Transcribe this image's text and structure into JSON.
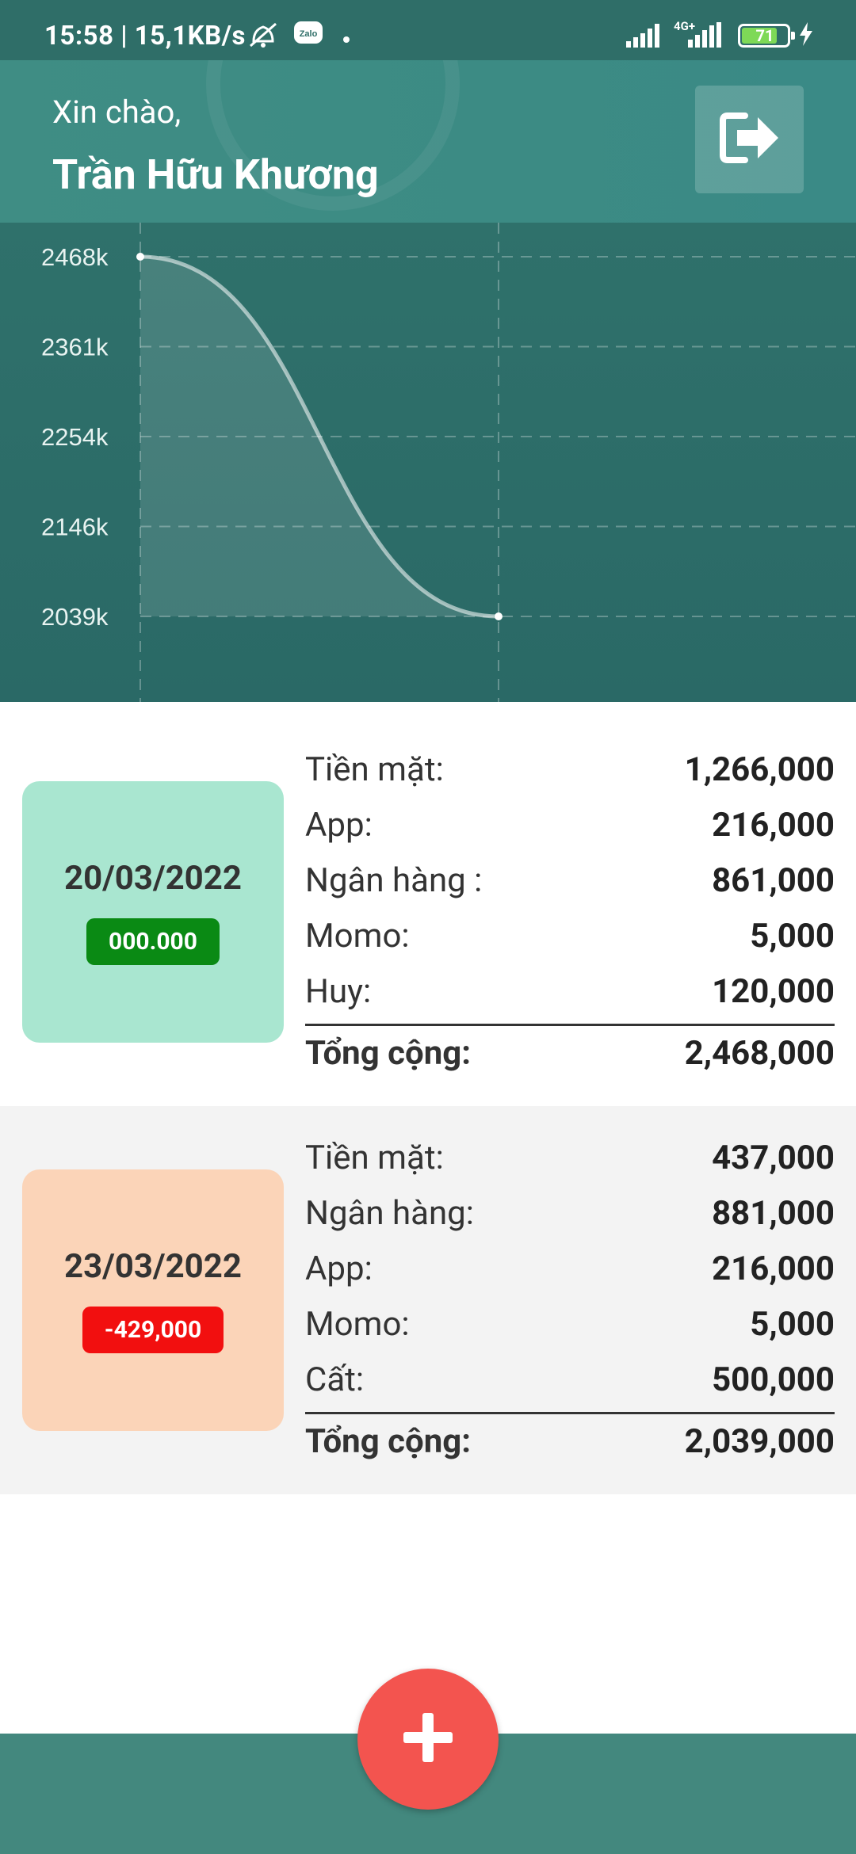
{
  "status_bar": {
    "time": "15:58 | 15,1KB/s",
    "network_label": "4G+",
    "battery": "71",
    "icons": [
      "muted-alarm-icon",
      "zalo-icon",
      "signal-icon",
      "charging-icon"
    ]
  },
  "header": {
    "greeting": "Xin chào,",
    "user_name": "Trần Hữu Khương",
    "logout_icon": "sign-out-icon"
  },
  "chart_data": {
    "type": "area",
    "x": [
      "20/03/2022",
      "23/03/2022"
    ],
    "values": [
      2468,
      2039
    ],
    "y_ticks": [
      "2468k",
      "2361k",
      "2254k",
      "2146k",
      "2039k"
    ],
    "ylim": [
      2039,
      2468
    ],
    "grid": true,
    "title": "",
    "xlabel": "",
    "ylabel": ""
  },
  "entries": [
    {
      "date": "20/03/2022",
      "diff": "000.000",
      "rows": [
        {
          "label": "Tiền mặt:",
          "value": "1,266,000"
        },
        {
          "label": "App:",
          "value": "216,000"
        },
        {
          "label": "Ngân hàng :",
          "value": "861,000"
        },
        {
          "label": "Momo:",
          "value": "5,000"
        },
        {
          "label": "Huy:",
          "value": "120,000"
        }
      ],
      "total_label": "Tổng cộng:",
      "total_value": "2,468,000"
    },
    {
      "date": "23/03/2022",
      "diff": "-429,000",
      "rows": [
        {
          "label": "Tiền mặt:",
          "value": "437,000"
        },
        {
          "label": "Ngân hàng:",
          "value": "881,000"
        },
        {
          "label": "App:",
          "value": "216,000"
        },
        {
          "label": "Momo:",
          "value": "5,000"
        },
        {
          "label": "Cất:",
          "value": "500,000"
        }
      ],
      "total_label": "Tổng cộng:",
      "total_value": "2,039,000"
    }
  ],
  "fab_icon": "plus-icon",
  "colors": {
    "header": "#3c8b84",
    "chart_bg": "#2c6c68",
    "positive_badge": "#0a8a14",
    "negative_badge": "#f20f0f",
    "card_1": "#a9e6d0",
    "card_2": "#fbd4b8",
    "fab": "#f3544f",
    "bottom_bar": "#43887e"
  }
}
